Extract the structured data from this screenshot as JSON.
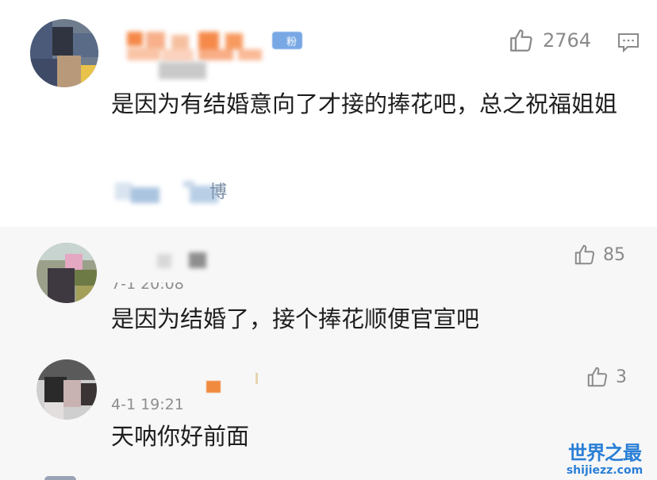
{
  "main_comment": {
    "badge_text": "粉",
    "likes": "2764",
    "text": "是因为有结婚意向了才接的捧花吧，总之祝福姐姐",
    "source_suffix": "博"
  },
  "replies": [
    {
      "likes": "85",
      "time": "7-1 20:08",
      "text": "是因为结婚了，接个捧花顺便官宣吧"
    },
    {
      "likes": "3",
      "time": "4-1 19:21",
      "text": "天呐你好前面"
    }
  ],
  "watermark": {
    "title": "世界之最",
    "url": "shijiezz.com"
  },
  "colors": {
    "like_gray": "#8a8a8a",
    "reply_bg": "#f7f7f7",
    "watermark_blue": "#2a7fd6",
    "username_orange": "#f5894a"
  }
}
